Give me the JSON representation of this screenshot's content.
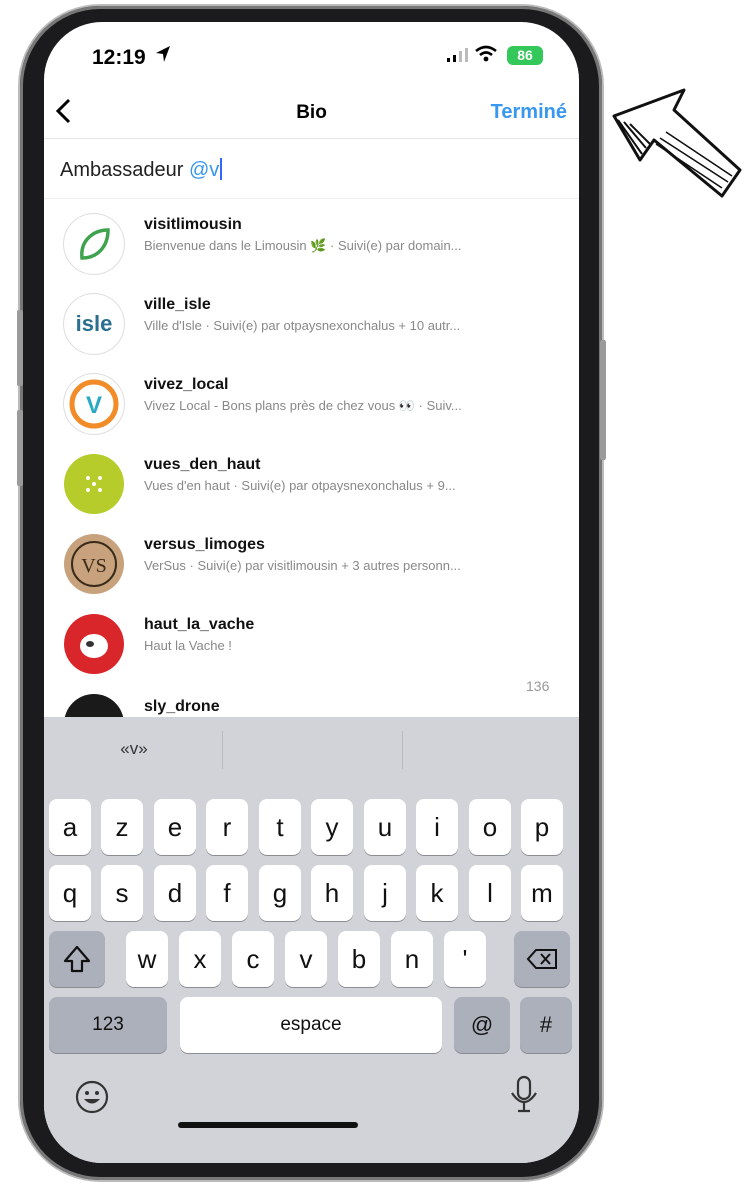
{
  "status": {
    "time": "12:19",
    "battery": "86"
  },
  "nav": {
    "title": "Bio",
    "done": "Terminé"
  },
  "bio": {
    "prefix": "Ambassadeur ",
    "mention": "@v"
  },
  "suggestions": [
    {
      "username": "visitlimousin",
      "subtitle": "Bienvenue dans le Limousin 🌿 · Suivi(e) par domain..."
    },
    {
      "username": "ville_isle",
      "subtitle": "Ville d'Isle · Suivi(e) par otpaysnexonchalus + 10 autr..."
    },
    {
      "username": "vivez_local",
      "subtitle": "Vivez Local - Bons plans près de chez vous 👀 · Suiv..."
    },
    {
      "username": "vues_den_haut",
      "subtitle": "Vues d'en haut · Suivi(e) par otpaysnexonchalus + 9..."
    },
    {
      "username": "versus_limoges",
      "subtitle": "VerSus · Suivi(e) par visitlimousin + 3 autres personn..."
    },
    {
      "username": "haut_la_vache",
      "subtitle": "Haut la Vache !"
    },
    {
      "username": "sly_drone",
      "subtitle": ""
    }
  ],
  "avatar_text": {
    "isle": "isle",
    "local": "V",
    "versus": "VS"
  },
  "char_counter": "136",
  "keyboard": {
    "suggestion": "«v»",
    "row1": [
      "a",
      "z",
      "e",
      "r",
      "t",
      "y",
      "u",
      "i",
      "o",
      "p"
    ],
    "row2": [
      "q",
      "s",
      "d",
      "f",
      "g",
      "h",
      "j",
      "k",
      "l",
      "m"
    ],
    "row3": [
      "w",
      "x",
      "c",
      "v",
      "b",
      "n",
      "'"
    ],
    "numbers": "123",
    "space": "espace",
    "at": "@",
    "hash": "#"
  },
  "colors": {
    "accent": "#3897f0",
    "keyboard_bg": "#d1d3d9",
    "battery": "#34c759"
  },
  "icons": [
    "location-arrow-icon",
    "signal-icon",
    "wifi-icon",
    "battery-icon",
    "back-chevron-icon",
    "shift-icon",
    "backspace-icon",
    "emoji-icon",
    "microphone-icon",
    "hand-drawn-arrow-icon"
  ]
}
